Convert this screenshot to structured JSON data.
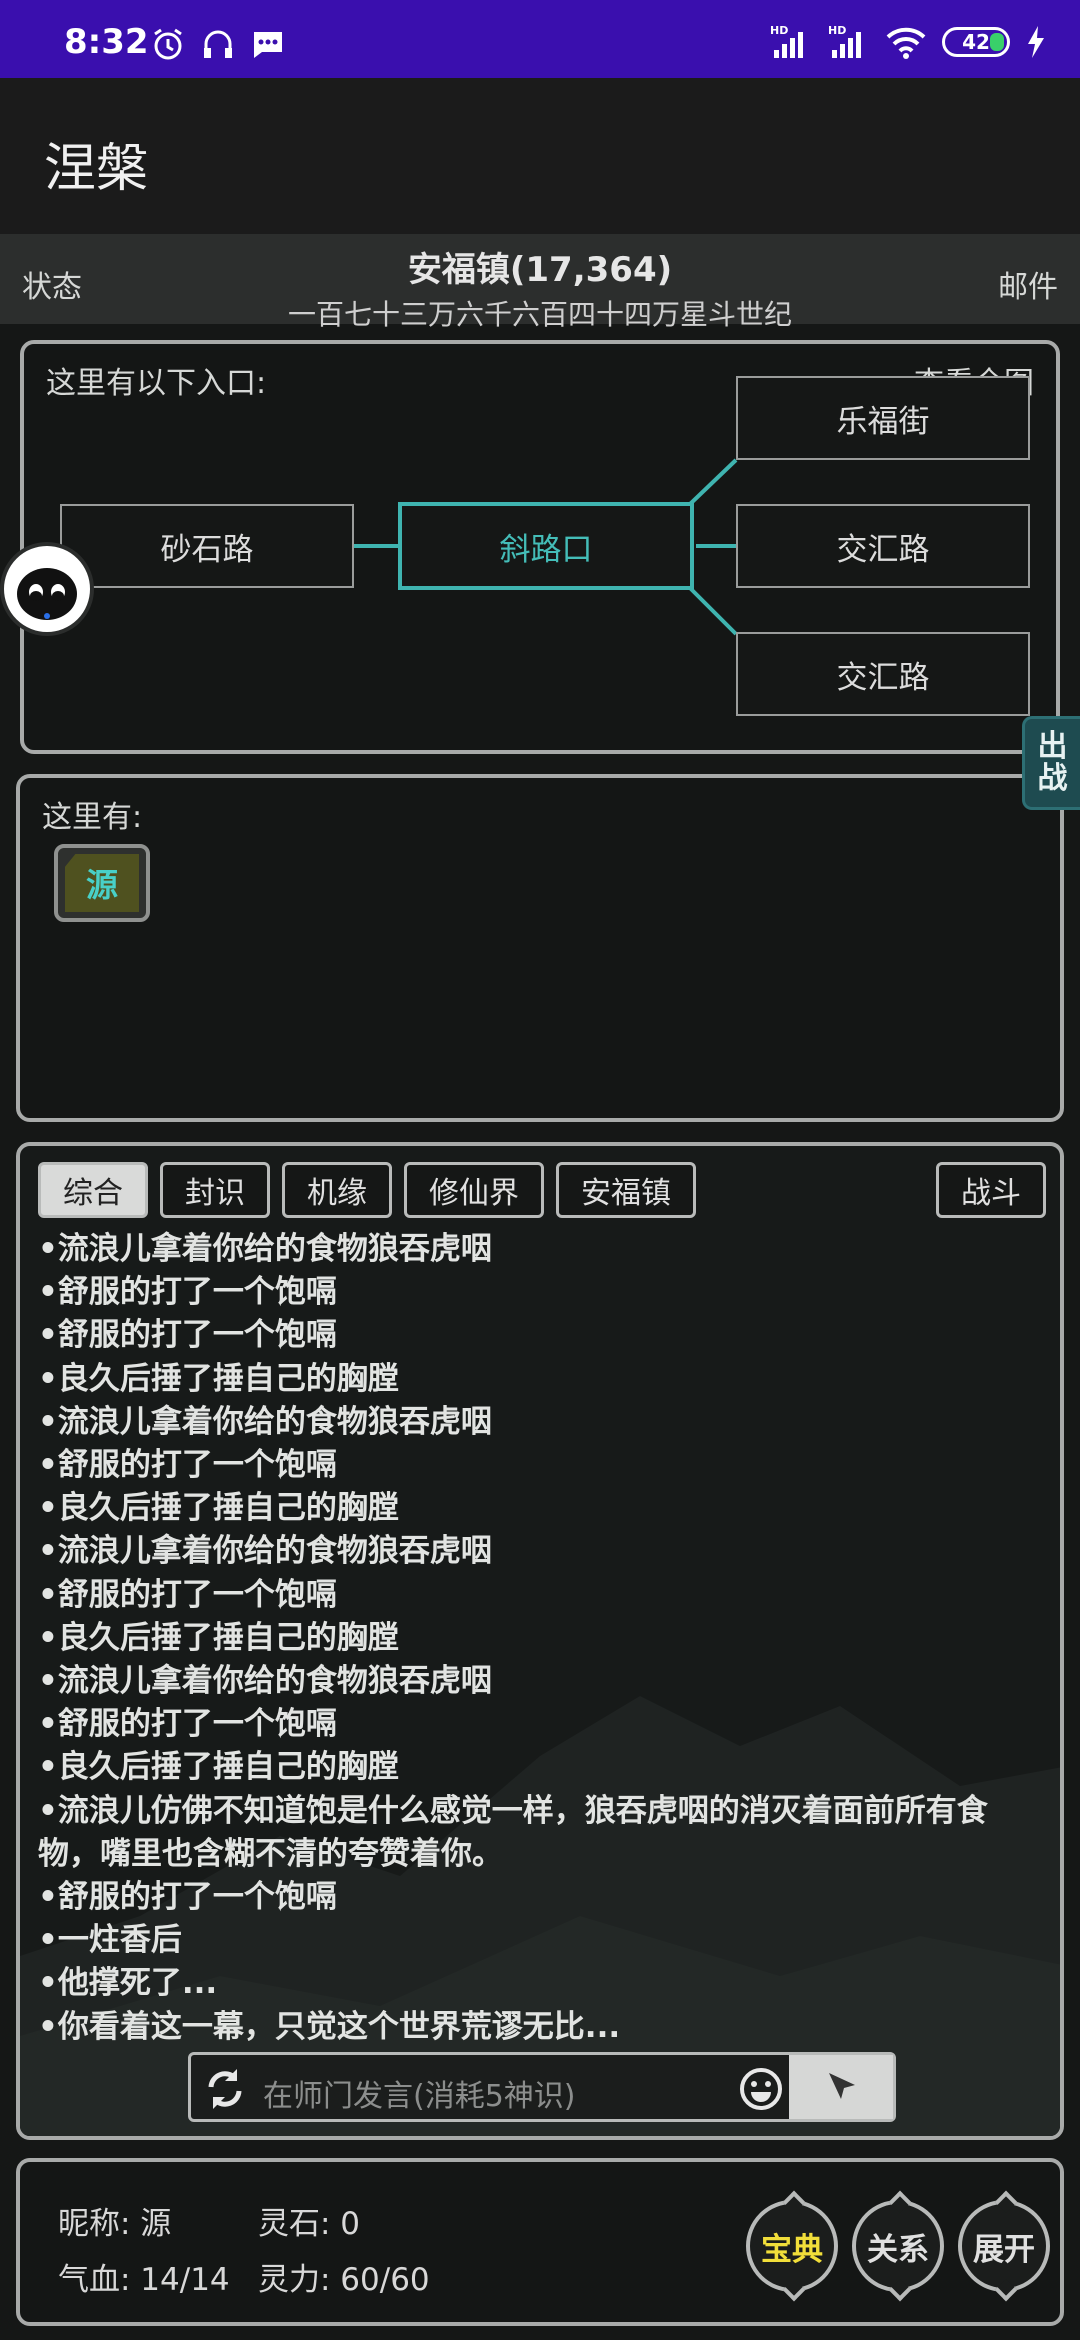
{
  "status_bar": {
    "time": "8:32",
    "battery": "42",
    "icons": [
      "alarm-icon",
      "headset-icon",
      "chat-icon",
      "hd-signal-icon",
      "hd-signal-icon",
      "wifi-icon",
      "battery-icon",
      "charging-icon"
    ],
    "signal_labels": [
      "HD",
      "HD"
    ]
  },
  "app_bar": {
    "title": "涅槃"
  },
  "location_bar": {
    "left": "状态",
    "right": "邮件",
    "town": "安福镇(17,364)",
    "era": "一百七十三万六千六百四十四万星斗世纪"
  },
  "map": {
    "header": "这里有以下入口:",
    "view_all": "查看全图",
    "west": "砂石路",
    "current": "斜路口",
    "east_top": "乐福街",
    "east_mid": "交汇路",
    "east_bottom": "交汇路",
    "accent_color": "#3fb4b0"
  },
  "here": {
    "header": "这里有:",
    "item_label": "源"
  },
  "log": {
    "tabs": [
      "综合",
      "封识",
      "机缘",
      "修仙界",
      "安福镇"
    ],
    "fight_tab": "战斗",
    "lines": [
      "•流浪儿拿着你给的食物狼吞虎咽",
      "•舒服的打了一个饱嗝",
      "•舒服的打了一个饱嗝",
      "•良久后捶了捶自己的胸膛",
      "•流浪儿拿着你给的食物狼吞虎咽",
      "•舒服的打了一个饱嗝",
      "•良久后捶了捶自己的胸膛",
      "•流浪儿拿着你给的食物狼吞虎咽",
      "•舒服的打了一个饱嗝",
      "•良久后捶了捶自己的胸膛",
      "•流浪儿拿着你给的食物狼吞虎咽",
      "•舒服的打了一个饱嗝",
      "•良久后捶了捶自己的胸膛",
      "•流浪儿仿佛不知道饱是什么感觉一样，狼吞虎咽的消灭着面前所有食",
      "物，嘴里也含糊不清的夸赞着你。",
      "•舒服的打了一个饱嗝",
      "•一炷香后",
      "•他撑死了...",
      "•你看着这一幕，只觉这个世界荒谬无比..."
    ],
    "chat_placeholder": "在师门发言(消耗5神识)"
  },
  "player": {
    "nickname": "昵称: 源",
    "spirit_stone": "灵石: 0",
    "hp": "气血: 14/14",
    "mana": "灵力: 60/60",
    "btn_treasure": "宝典",
    "btn_relation": "关系",
    "btn_expand": "展开"
  },
  "side": {
    "fight_top": "出",
    "fight_bottom": "战"
  }
}
